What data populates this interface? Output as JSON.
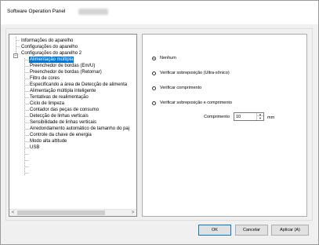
{
  "window": {
    "title": "Software Operation Panel"
  },
  "tree": {
    "items": [
      {
        "label": "Informações do aparelho"
      },
      {
        "label": "Configurações do aparelho"
      },
      {
        "label": "Configurações do aparelho 2"
      },
      {
        "label": "Alimentação múltipla",
        "selected": true
      },
      {
        "label": "Preenchedor de bordas (Em/U)"
      },
      {
        "label": "Preenchedor de bordas (Retornar)"
      },
      {
        "label": "Filtro de cores"
      },
      {
        "label": "Especificando a área de Detecção de alimenta"
      },
      {
        "label": "Alimentação múltipla inteligente"
      },
      {
        "label": "Tentativas de realimentação"
      },
      {
        "label": "Ciclo de limpeza"
      },
      {
        "label": "Contador das peças de consumo"
      },
      {
        "label": "Detecção de linhas verticais"
      },
      {
        "label": "Sensibilidade de linhas verticais"
      },
      {
        "label": "Arredondamento automático de tamanho do paj"
      },
      {
        "label": "Controle da chave de energia"
      },
      {
        "label": "Modo alta altitude"
      },
      {
        "label": "USB"
      }
    ],
    "expander_symbol": "−",
    "scroll_left": "<",
    "scroll_right": ">"
  },
  "options": {
    "radios": [
      {
        "label": "Nenhum",
        "checked": true
      },
      {
        "label": "Verificar sobreposição (Ultra-sônico)",
        "checked": false
      },
      {
        "label": "Verificar comprimento",
        "checked": false
      },
      {
        "label": "Verificar sobreposição e comprimento",
        "checked": false
      }
    ],
    "length_label": "Comprimento",
    "length_value": "10",
    "length_unit": "mm",
    "spin_up": "▲",
    "spin_down": "▼"
  },
  "buttons": {
    "ok": "OK",
    "cancel": "Cancelar",
    "apply": "Aplicar (A)"
  }
}
